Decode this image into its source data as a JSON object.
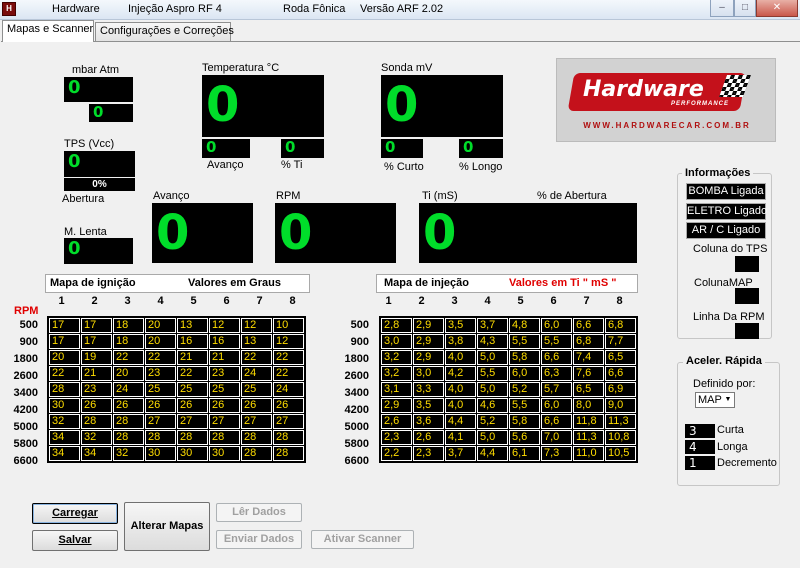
{
  "titlebar": {
    "app_name": "Hardware",
    "injection": "Injeção Aspro",
    "rf": "RF 4",
    "wheel": "Roda  Fônica",
    "version": "Versão  ARF 2.02"
  },
  "tabs": [
    "Mapas e Scanner",
    "Configurações e Correções"
  ],
  "sensors": {
    "mbar_label": "mbar  Atm",
    "mbar_value": "0",
    "atm_value": "0",
    "temperature_label": "Temperatura  °C",
    "temperature_value": "0",
    "avanco_small_value": "0",
    "avanco_small_label": "Avanço",
    "ti_pct_value": "0",
    "ti_pct_label": "%  Ti",
    "sonda_label": "Sonda  mV",
    "sonda_value": "0",
    "curto_value": "0",
    "curto_label": "% Curto",
    "longo_value": "0",
    "longo_label": "% Longo",
    "tps_label": "TPS  (Vcc)",
    "tps_value": "0",
    "tps_bar": "0%",
    "abertura_label": "Abertura",
    "mlenta_label": "M. Lenta",
    "mlenta_value": "0",
    "avanco_label": "Avanço",
    "avanco_value": "0",
    "rpm_label": "RPM",
    "rpm_value": "0",
    "ti_label": "Ti (mS)",
    "ti_value": "0",
    "pct_abertura_label": "% de Abertura"
  },
  "logo": {
    "word": "Hardware",
    "tagline": "PERFORMANCE",
    "url": "WWW.HARDWARECAR.COM.BR"
  },
  "info": {
    "title": "Informações",
    "status": [
      "BOMBA Ligada",
      "ELETRO Ligado",
      "AR / C   Ligado"
    ],
    "coluna_tps": "Coluna do TPS",
    "coluna_map": "ColunaMAP",
    "linha_rpm": "Linha Da RPM"
  },
  "accel": {
    "title": "Aceler. Rápida",
    "definido_label": "Definido por:",
    "definido_value": "MAP",
    "curta_value": "3",
    "curta_label": "Curta",
    "longa_value": "4",
    "longa_label": "Longa",
    "decremento_value": "1",
    "decremento_label": "Decremento"
  },
  "ignition": {
    "title": "Mapa de ignição",
    "units": "Valores em  Graus",
    "columns": [
      "1",
      "2",
      "3",
      "4",
      "5",
      "6",
      "7",
      "8"
    ],
    "rpm_header": "RPM",
    "rpms": [
      "500",
      "900",
      "1800",
      "2600",
      "3400",
      "4200",
      "5000",
      "5800",
      "6600"
    ],
    "rows": [
      [
        "17",
        "17",
        "18",
        "20",
        "13",
        "12",
        "12",
        "10"
      ],
      [
        "17",
        "17",
        "18",
        "20",
        "16",
        "16",
        "13",
        "12"
      ],
      [
        "20",
        "19",
        "22",
        "22",
        "21",
        "21",
        "22",
        "22"
      ],
      [
        "22",
        "21",
        "20",
        "23",
        "22",
        "23",
        "24",
        "22"
      ],
      [
        "28",
        "23",
        "24",
        "25",
        "25",
        "25",
        "25",
        "24"
      ],
      [
        "30",
        "26",
        "26",
        "26",
        "26",
        "26",
        "26",
        "26"
      ],
      [
        "32",
        "28",
        "28",
        "27",
        "27",
        "27",
        "27",
        "27"
      ],
      [
        "34",
        "32",
        "28",
        "28",
        "28",
        "28",
        "28",
        "28"
      ],
      [
        "34",
        "34",
        "32",
        "30",
        "30",
        "30",
        "28",
        "28"
      ]
    ]
  },
  "injection": {
    "title": "Mapa de injeção",
    "units": "Valores em Ti   \" mS \"",
    "units_color": "#e00000",
    "columns": [
      "1",
      "2",
      "3",
      "4",
      "5",
      "6",
      "7",
      "8"
    ],
    "rpms": [
      "500",
      "900",
      "1800",
      "2600",
      "3400",
      "4200",
      "5000",
      "5800",
      "6600"
    ],
    "rows": [
      [
        "2,8",
        "2,9",
        "3,5",
        "3,7",
        "4,8",
        "6,0",
        "6,6",
        "6,8"
      ],
      [
        "3,0",
        "2,9",
        "3,8",
        "4,3",
        "5,5",
        "5,5",
        "6,8",
        "7,7"
      ],
      [
        "3,2",
        "2,9",
        "4,0",
        "5,0",
        "5,8",
        "6,6",
        "7,4",
        "6,5"
      ],
      [
        "3,2",
        "3,0",
        "4,2",
        "5,5",
        "6,0",
        "6,3",
        "7,6",
        "6,6"
      ],
      [
        "3,1",
        "3,3",
        "4,0",
        "5,0",
        "5,2",
        "5,7",
        "6,5",
        "6,9"
      ],
      [
        "2,9",
        "3,5",
        "4,0",
        "4,6",
        "5,5",
        "6,0",
        "8,0",
        "9,0"
      ],
      [
        "2,6",
        "3,6",
        "4,4",
        "5,2",
        "5,8",
        "6,6",
        "11,8",
        "11,3"
      ],
      [
        "2,3",
        "2,6",
        "4,1",
        "5,0",
        "5,6",
        "7,0",
        "11,3",
        "10,8"
      ],
      [
        "2,2",
        "2,3",
        "3,7",
        "4,4",
        "6,1",
        "7,3",
        "11,0",
        "10,5"
      ]
    ]
  },
  "buttons": {
    "carregar": "Carregar",
    "salvar": "Salvar",
    "alterar": "Alterar Mapas",
    "ler": "Lêr  Dados",
    "enviar": "Enviar  Dados",
    "scanner": "Ativar Scanner"
  },
  "colors": {
    "display_green": "#00dd2a",
    "cell_yellow": "#ffdd00",
    "rpm_red": "#e00000"
  }
}
